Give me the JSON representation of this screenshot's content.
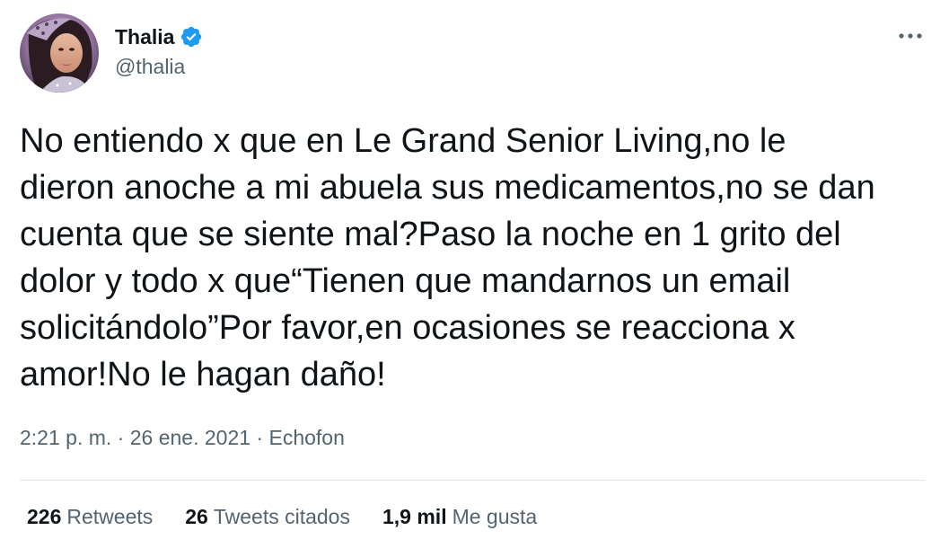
{
  "author": {
    "display_name": "Thalia",
    "handle": "@thalia",
    "verified": true,
    "avatar_icon": "profile-photo"
  },
  "tweet": {
    "text": "No entiendo x que en Le Grand Senior Living,no le\ndieron anoche a mi abuela sus medicamentos,no se dan\ncuenta que se siente mal?Paso la noche en 1 grito del\ndolor y todo x que“Tienen que mandarnos un email\nsolicitándolo”Por favor,en ocasiones se reacciona x\namor!No le hagan daño!"
  },
  "meta": {
    "time": "2:21 p. m.",
    "sep1": "·",
    "date": "26 ene. 2021",
    "sep2": "·",
    "source": "Echofon"
  },
  "stats": {
    "retweets_count": "226",
    "retweets_label": "Retweets",
    "quotes_count": "26",
    "quotes_label": "Tweets citados",
    "likes_count": "1,9 mil",
    "likes_label": "Me gusta"
  },
  "colors": {
    "verified_blue": "#1d9bf0",
    "secondary_text": "#536471",
    "primary_text": "#0f1419",
    "divider": "#e1e8ed"
  }
}
